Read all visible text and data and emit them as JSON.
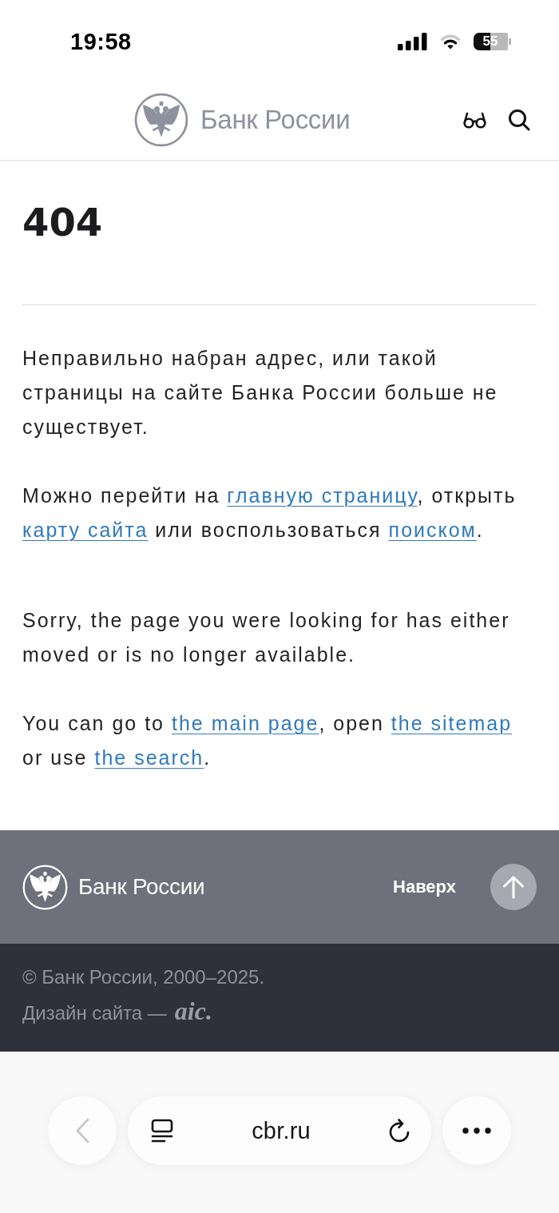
{
  "status_bar": {
    "time": "19:58",
    "battery": "55"
  },
  "header": {
    "brand": "Банк России"
  },
  "content": {
    "title": "404",
    "sections": [
      {
        "paragraphs": [
          {
            "segments": [
              {
                "kind": "text",
                "text": "Неправильно набран адрес, или такой страницы на сайте Банка России больше не существует."
              }
            ]
          },
          {
            "segments": [
              {
                "kind": "text",
                "text": "Можно перейти на "
              },
              {
                "kind": "link",
                "text": "главную страницу"
              },
              {
                "kind": "text",
                "text": ", открыть "
              },
              {
                "kind": "link",
                "text": "карту сайта"
              },
              {
                "kind": "text",
                "text": " или воспользоваться "
              },
              {
                "kind": "link",
                "text": "поиском"
              },
              {
                "kind": "text",
                "text": "."
              }
            ]
          }
        ]
      },
      {
        "paragraphs": [
          {
            "segments": [
              {
                "kind": "text",
                "text": "Sorry, the page you were looking for has either moved or is no longer available."
              }
            ]
          },
          {
            "segments": [
              {
                "kind": "text",
                "text": "You can go to "
              },
              {
                "kind": "link",
                "text": "the main page"
              },
              {
                "kind": "text",
                "text": ", open "
              },
              {
                "kind": "link",
                "text": "the sitemap"
              },
              {
                "kind": "text",
                "text": " or use "
              },
              {
                "kind": "link",
                "text": "the search"
              },
              {
                "kind": "text",
                "text": "."
              }
            ]
          }
        ]
      }
    ]
  },
  "footer": {
    "brand": "Банк России",
    "to_top": "Наверх",
    "copyright": "© Банк России, 2000–2025.",
    "credit": "Дизайн сайта —",
    "studio": "aic."
  },
  "browser_bar": {
    "back": {
      "disabled": true
    },
    "url": "cbr.ru"
  }
}
